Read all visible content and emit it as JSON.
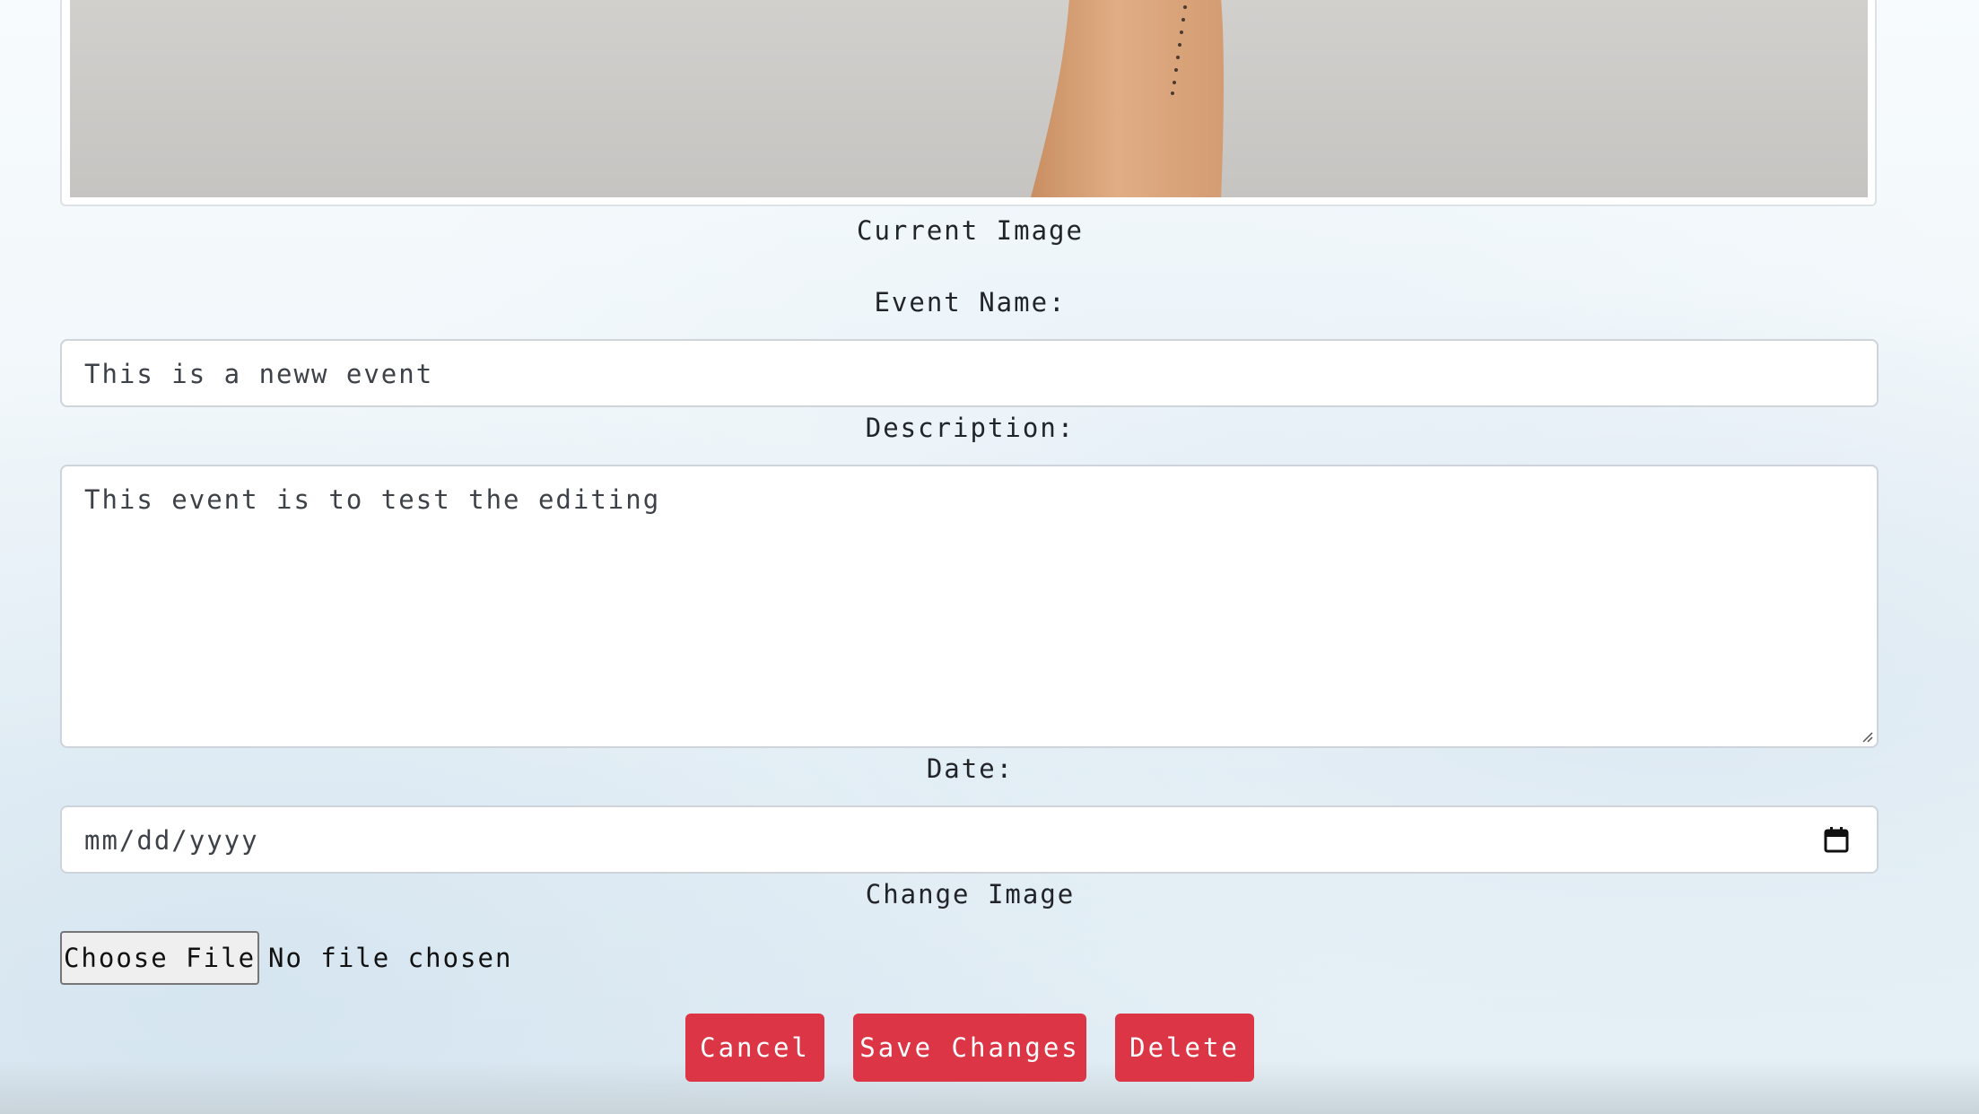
{
  "current_image": {
    "caption": "Current Image"
  },
  "event_name": {
    "label": "Event Name:",
    "value": "This is a neww event"
  },
  "description": {
    "label": "Description:",
    "value": "This event is to test the editing"
  },
  "date": {
    "label": "Date:",
    "placeholder": "mm/dd/yyyy",
    "icon": "calendar-icon"
  },
  "change_image": {
    "label": "Change Image",
    "button_label": "Choose File",
    "status": "No file chosen"
  },
  "actions": {
    "cancel": "Cancel",
    "save": "Save Changes",
    "delete": "Delete"
  },
  "colors": {
    "button": "#dc3545",
    "field_border": "#ced4da",
    "background": "#eef5f9"
  }
}
